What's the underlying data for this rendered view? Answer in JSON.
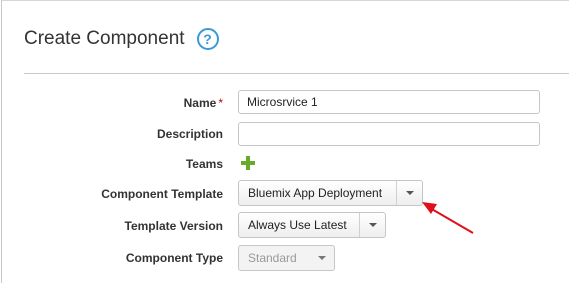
{
  "dialog": {
    "title": "Create Component",
    "help_glyph": "?"
  },
  "form": {
    "name": {
      "label": "Name",
      "required_mark": "*",
      "value": "Microsrvice 1"
    },
    "description": {
      "label": "Description",
      "value": ""
    },
    "teams": {
      "label": "Teams"
    },
    "component_template": {
      "label": "Component Template",
      "selected": "Bluemix App Deployment"
    },
    "template_version": {
      "label": "Template Version",
      "selected": "Always Use Latest"
    },
    "component_type": {
      "label": "Component Type",
      "selected": "Standard",
      "disabled": true
    }
  },
  "colors": {
    "accent_help": "#3a9ad9",
    "add_icon": "#6aaa2b",
    "required": "#cc0000",
    "annotation_arrow": "#e0101a"
  },
  "icons": [
    "help-icon",
    "add-team-icon",
    "chevron-down-icon",
    "annotation-arrow"
  ]
}
